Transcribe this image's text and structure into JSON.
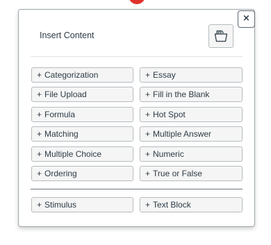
{
  "header": {
    "title": "Insert Content",
    "close_label": "×"
  },
  "options_plus": "+",
  "options": [
    "Categorization",
    "Essay",
    "File Upload",
    "Fill in the Blank",
    "Formula",
    "Hot Spot",
    "Matching",
    "Multiple Answer",
    "Multiple Choice",
    "Numeric",
    "Ordering",
    "True or False"
  ],
  "extra_options": [
    "Stimulus",
    "Text Block"
  ],
  "icons": {
    "close": "close-icon",
    "header_button": "item-bank-icon"
  },
  "colors": {
    "border": "#9ea6ad",
    "button_bg": "#f5f5f5",
    "text": "#2d3b45",
    "top_marker": "#e0322c"
  }
}
